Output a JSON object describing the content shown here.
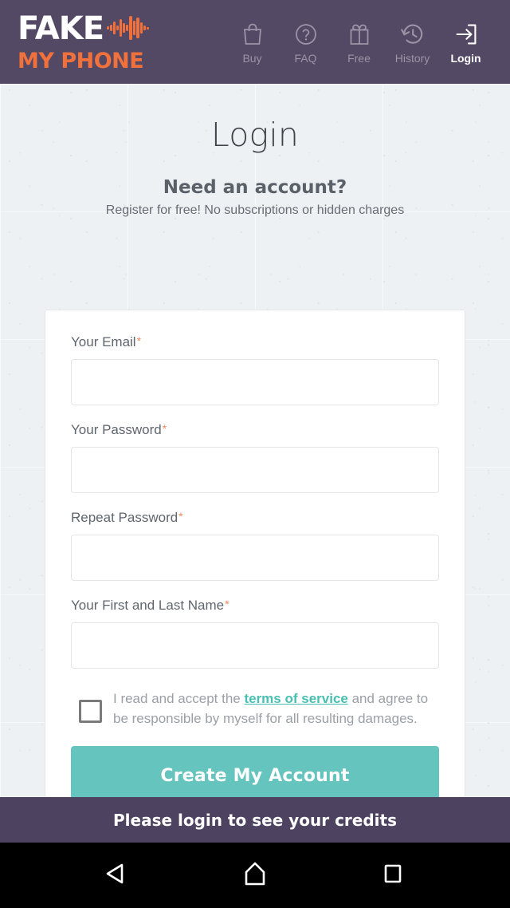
{
  "header": {
    "logo": {
      "line1": "FAKE",
      "line2": "MY PHONE",
      "waveform_icon": "audio-waveform-icon",
      "color_line1": "#ffffff",
      "color_line2": "#f0713c"
    },
    "background_color": "#544964",
    "nav": [
      {
        "label": "Buy",
        "icon": "shopping-bag-icon",
        "active": false
      },
      {
        "label": "FAQ",
        "icon": "question-circle-icon",
        "active": false
      },
      {
        "label": "Free",
        "icon": "gift-icon",
        "active": false
      },
      {
        "label": "History",
        "icon": "history-clock-icon",
        "active": false
      },
      {
        "label": "Login",
        "icon": "login-arrow-icon",
        "active": true
      }
    ]
  },
  "main": {
    "page_title": "Login",
    "sub_heading": "Need an account?",
    "sub_text": "Register for free! No subscriptions or hidden charges",
    "form": {
      "fields": [
        {
          "label": "Your Email",
          "required_marker": "*",
          "value": "",
          "placeholder": ""
        },
        {
          "label": "Your Password",
          "required_marker": "*",
          "value": "",
          "placeholder": ""
        },
        {
          "label": "Repeat Password",
          "required_marker": "*",
          "value": "",
          "placeholder": ""
        },
        {
          "label": "Your First and Last Name",
          "required_marker": "*",
          "value": "",
          "placeholder": ""
        }
      ],
      "terms": {
        "text_before": "I read and accept the ",
        "link_text": "terms of service",
        "text_after": " and agree to be responsible by myself for all resulting damages.",
        "checked": false,
        "link_color": "#48bfb2"
      },
      "submit_label": "Create My Account",
      "submit_color": "#66c4bf",
      "required_marker_color": "#f58a62"
    }
  },
  "credits_bar": {
    "message": "Please login to see your credits",
    "background_color": "#4d4360"
  },
  "android_nav": {
    "back_icon": "back-triangle-icon",
    "home_icon": "home-icon",
    "recents_icon": "recents-square-icon"
  }
}
